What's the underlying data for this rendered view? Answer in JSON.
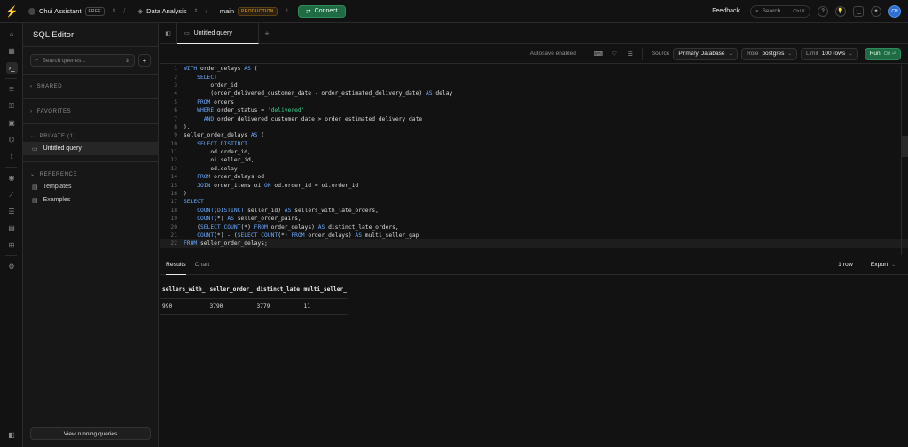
{
  "topbar": {
    "org_name": "Chui Assistant",
    "org_plan": "FREE",
    "project_name": "Data Analysis",
    "branch": "main",
    "branch_env": "PRODUCTION",
    "connect_label": "Connect",
    "feedback_label": "Feedback",
    "search_placeholder": "Search...",
    "search_shortcut": "Ctrl K",
    "avatar_initials": "CH"
  },
  "sidebar": {
    "title": "SQL Editor",
    "search_placeholder": "Search queries...",
    "sections": {
      "shared": "SHARED",
      "favorites": "FAVORITES",
      "private": "PRIVATE (1)",
      "reference": "REFERENCE"
    },
    "private_items": [
      "Untitled query"
    ],
    "reference_items": [
      "Templates",
      "Examples"
    ],
    "bottom_button": "View running queries"
  },
  "tabs": [
    {
      "label": "Untitled query"
    }
  ],
  "toolbar": {
    "autosave": "Autosave enabled",
    "source_label": "Source",
    "source_value": "Primary Database",
    "role_label": "Role",
    "role_value": "postgres",
    "limit_label": "Limit",
    "limit_value": "100 rows",
    "run_label": "Run",
    "run_shortcut": "Ctrl ⏎"
  },
  "editor": {
    "current_line": 22,
    "lines": [
      "WITH order_delays AS (",
      "    SELECT",
      "        order_id,",
      "        (order_delivered_customer_date - order_estimated_delivery_date) AS delay",
      "    FROM orders",
      "    WHERE order_status = 'delivered'",
      "      AND order_delivered_customer_date > order_estimated_delivery_date",
      "),",
      "seller_order_delays AS (",
      "    SELECT DISTINCT",
      "        od.order_id,",
      "        oi.seller_id,",
      "        od.delay",
      "    FROM order_delays od",
      "    JOIN order_items oi ON od.order_id = oi.order_id",
      ")",
      "SELECT",
      "    COUNT(DISTINCT seller_id) AS sellers_with_late_orders,",
      "    COUNT(*) AS seller_order_pairs,",
      "    (SELECT COUNT(*) FROM order_delays) AS distinct_late_orders,",
      "    COUNT(*) - (SELECT COUNT(*) FROM order_delays) AS multi_seller_gap",
      "FROM seller_order_delays;"
    ]
  },
  "results": {
    "tabs": [
      "Results",
      "Chart"
    ],
    "row_count": "1 row",
    "export_label": "Export",
    "columns": [
      "sellers_with_",
      "seller_order_",
      "distinct_late",
      "multi_seller_"
    ],
    "rows": [
      [
        "990",
        "3790",
        "3779",
        "11"
      ]
    ]
  }
}
